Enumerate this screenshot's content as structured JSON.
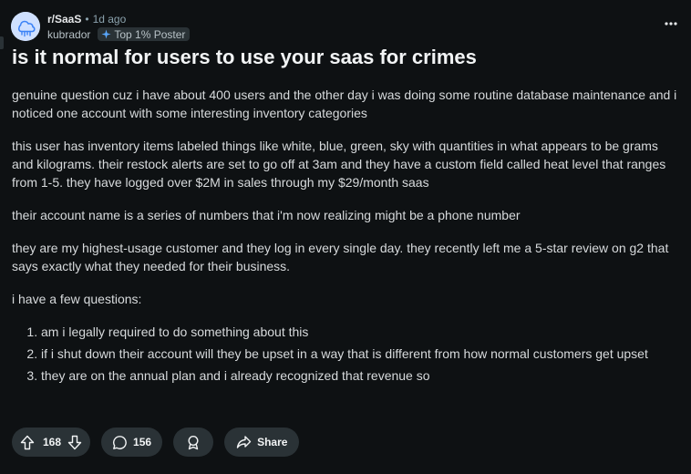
{
  "post": {
    "subreddit": "r/SaaS",
    "age": "1d ago",
    "author": "kubrador",
    "flair": "Top 1% Poster",
    "title": "is it normal for users to use your saas for crimes",
    "paragraphs": [
      "genuine question cuz i have about 400 users and the other day i was doing some routine database maintenance and i noticed one account with some interesting inventory categories",
      "this user has inventory items labeled things like white, blue, green, sky with quantities in what appears to be grams and kilograms. their restock alerts are set to go off at 3am and they have a custom field called heat level that ranges from 1-5. they have logged over $2M in sales through my $29/month saas",
      "their account name is a series of numbers that i'm now realizing might be a phone number",
      "they are my highest-usage customer and they log in every single day. they recently left me a 5-star review on g2 that says exactly what they needed for their business.",
      "i have a few questions:"
    ],
    "questions": [
      "am i legally required to do something about this",
      "if i shut down their account will they be upset in a way that is different from how normal customers get upset",
      "they are on the annual plan and i already recognized that revenue so"
    ]
  },
  "actions": {
    "score": "168",
    "comments": "156",
    "share_label": "Share"
  },
  "icons": {
    "avatar": "cloud-avatar-icon",
    "flair": "sparkle-icon",
    "more": "ellipsis-icon",
    "upvote": "upvote-arrow-icon",
    "downvote": "downvote-arrow-icon",
    "comment": "comment-bubble-icon",
    "award": "award-icon",
    "share": "share-arrow-icon"
  },
  "colors": {
    "background": "#0e1113",
    "pill": "#2a3236",
    "avatar_bg": "#cfe0ff",
    "avatar_fg": "#3b82f6"
  }
}
